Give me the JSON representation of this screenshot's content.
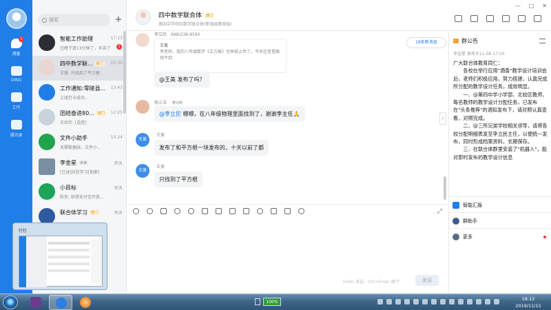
{
  "rail": {
    "items": [
      {
        "label": "消息",
        "badge": "1"
      },
      {
        "label": "DING"
      },
      {
        "label": "工作"
      },
      {
        "label": "通讯录"
      }
    ]
  },
  "list": {
    "search_placeholder": "搜索",
    "plus": "+",
    "conversations": [
      {
        "name": "智能工作助理",
        "time": "17:13",
        "preview": "已晚下班13分钟了，辛苦了",
        "badge": "1",
        "avatar_color": "#2a2d33"
      },
      {
        "name": "四中数学联...",
        "tag": "部门",
        "time": "15:35",
        "preview": "王美: 只找到了平方根",
        "avatar_color": "#e9d6d0"
      },
      {
        "name": "工作通知:零陵县...",
        "time": "13:43",
        "preview": "上班打卡成功...",
        "avatar_color": "#1f7ee8"
      },
      {
        "name": "团结奋进80...",
        "tag": "部门",
        "time": "12:25",
        "preview": "王尚玲: [语音]",
        "avatar_color": "#c9d3dc"
      },
      {
        "name": "文件小助手",
        "time": "10-24",
        "preview": "无需数据线，文件小...",
        "avatar_color": "#22a34d"
      },
      {
        "name": "李金星",
        "tag": "未读",
        "time": "昨天",
        "preview": "[已读]向您学习[抱拳]",
        "avatar_color": "#7a8fa3"
      },
      {
        "name": "小目标",
        "time": "昨天",
        "preview": "陈东: 获得支付宝开放...",
        "avatar_color": "#1ea35a"
      },
      {
        "name": "联合体学习",
        "tag": "部门",
        "time": "昨天",
        "preview": "",
        "avatar_color": "#2f5aa0"
      }
    ]
  },
  "header": {
    "title": "四中数学联合体",
    "tag": "部门",
    "subtitle": "第四中学校际数学联合体(新强县教育局)",
    "window_controls": [
      "—",
      "□",
      "✕"
    ]
  },
  "messages": {
    "new_messages": "18条新消息",
    "quote_name": "王美",
    "quote_text": "李老师，我的八年级数学《立方根》也早就上传了，今天往音里面找不到",
    "msg1": "@王美 发布了吗？",
    "msg2_sender": "杨三玉",
    "msg2_status": "学习中",
    "msg2_mention": "@李立民",
    "msg2_text": " 哪哪，在八年级物理里面找到了，谢谢李主任🙏",
    "msg3_sender": "王美",
    "msg3_avatar": "王美",
    "msg3_text": "发布了和平方根一块发布的，十天以前了都",
    "msg4_sender": "王美",
    "msg4_avatar": "王美",
    "msg4_text": "只找到了平方根",
    "top_sender": "李立民",
    "top_phone": "698/238-8590"
  },
  "input": {
    "hint": "Enter 发送，Ctrl+Enter 换行",
    "send": "发送",
    "expand": "⤢"
  },
  "announcement": {
    "title": "群公告",
    "meta": "李金星  发布于11-08 17:50",
    "body": "广大联合体教育同仁：\n　　各校在举行应用\"酒香\"教学设计培训会后，老师们积极应用，努力搭建，认真完成所分配的教学设计任务，成效明显。\n　　一、@第四中学小学部、北校区教师，每名教师的教学设计分配任务，已发布在\"头条推荐\"的通知发布下，请对照认真查看，对照完成。\n　　二、@三所兄弟学校相关领导，请将各校分配明细表发至李立民主任，以便统一发布，同时形成档案资料，长期保存。\n　　三、在联合体群里安装了\"机器人\"，能对即时发布的教学设计信息",
    "items": [
      "智能汇报",
      "群助手",
      "更多"
    ]
  },
  "thumbnail": {
    "title": "钉钉"
  },
  "taskbar": {
    "battery": "100%",
    "time": "18:12",
    "date": "2019/11/15"
  }
}
